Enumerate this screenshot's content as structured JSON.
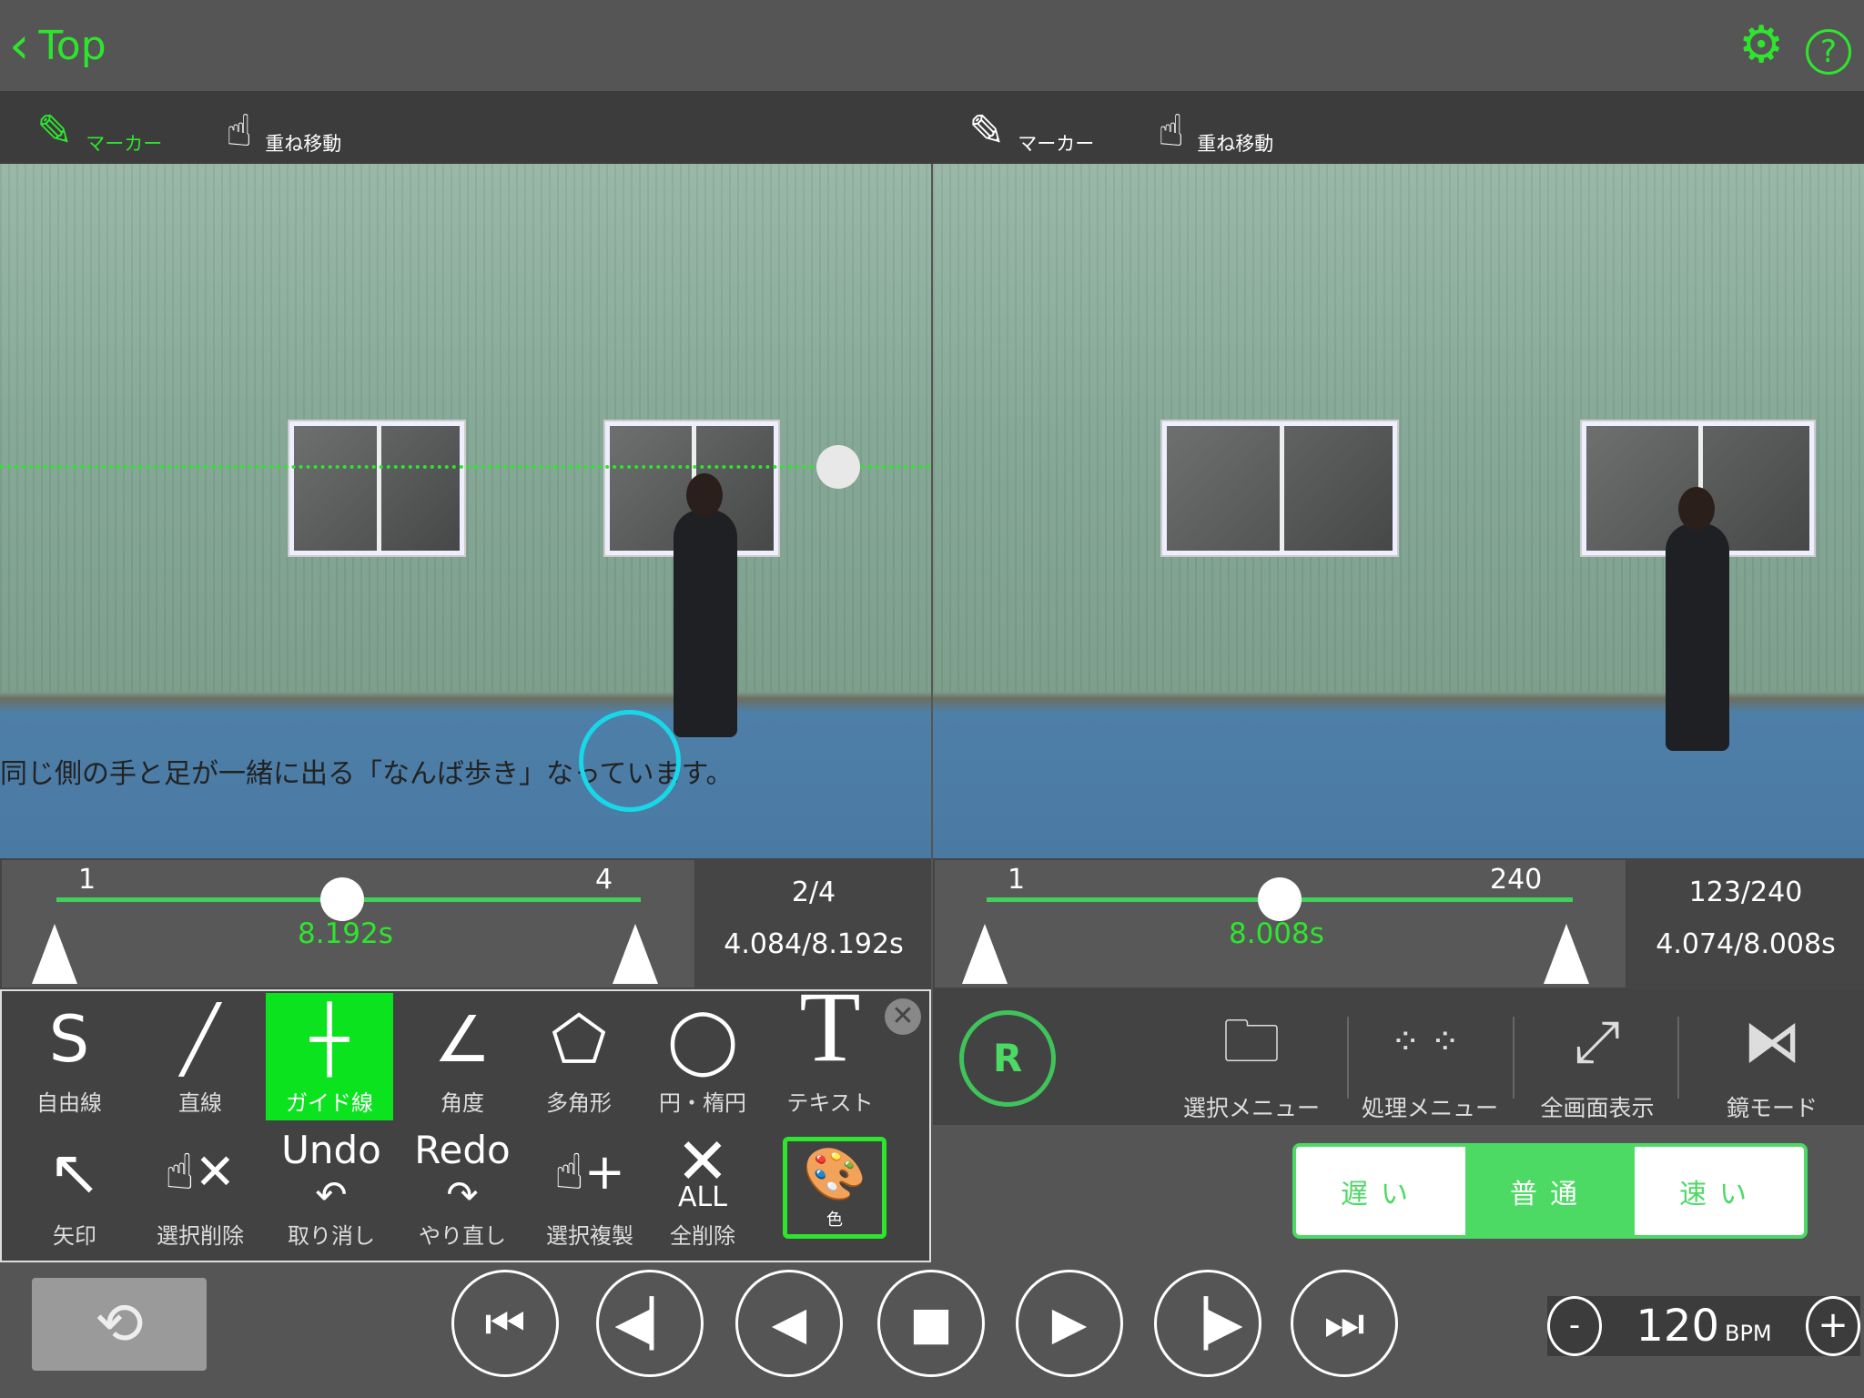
{
  "header": {
    "back_label": "Top",
    "settings_icon": "gear-icon",
    "help_label": "?"
  },
  "colors": {
    "accent": "#2ee52e",
    "speed_green": "#4cd964",
    "guide_line": "#2ee52e",
    "cursor_circle": "#18d8e8"
  },
  "left": {
    "toolbar": {
      "marker_label": "マーカー",
      "overlay_move_label": "重ね移動"
    },
    "caption": "同じ側の手と足が一緒に出る「なんば歩き」なっています。",
    "slider": {
      "start": "1",
      "end": "4",
      "time": "8.192s",
      "position_fraction": 0.5
    },
    "info": {
      "frame": "2/4",
      "time": "4.084/8.192s"
    }
  },
  "right": {
    "toolbar": {
      "marker_label": "マーカー",
      "overlay_move_label": "重ね移動"
    },
    "slider": {
      "start": "1",
      "end": "240",
      "time": "8.008s",
      "position_fraction": 0.51
    },
    "info": {
      "frame": "123/240",
      "time": "4.074/8.008s"
    }
  },
  "tools": {
    "row1": [
      {
        "label": "自由線",
        "icon": "S"
      },
      {
        "label": "直線",
        "icon": "╱"
      },
      {
        "label": "ガイド線",
        "icon": "┼"
      },
      {
        "label": "角度",
        "icon": "∠"
      },
      {
        "label": "多角形",
        "icon": "⬠"
      },
      {
        "label": "円・楕円",
        "icon": "◯"
      },
      {
        "label": "テキスト",
        "icon": "T"
      }
    ],
    "row2": [
      {
        "label": "矢印",
        "icon": "↖"
      },
      {
        "label": "選択削除",
        "icon": "☝✕"
      },
      {
        "label": "取り消し",
        "icon": "Undo"
      },
      {
        "label": "やり直し",
        "icon": "Redo"
      },
      {
        "label": "選択複製",
        "icon": "☝+"
      },
      {
        "label": "全削除",
        "icon": "✕"
      },
      {
        "label": "色",
        "icon": "🎨"
      }
    ],
    "all_label": "ALL",
    "selected": "ガイド線"
  },
  "right_menu": {
    "record_label": "R",
    "items": [
      {
        "label": "選択メニュー",
        "icon": "folder-icon"
      },
      {
        "label": "処理メニュー",
        "icon": "dots-grid-icon"
      },
      {
        "label": "全画面表示",
        "icon": "expand-icon"
      },
      {
        "label": "鏡モード",
        "icon": "mirror-icon"
      }
    ]
  },
  "speed": {
    "options": [
      "遅い",
      "普通",
      "速い"
    ],
    "selected": "普通"
  },
  "playback": {
    "buttons": [
      "first",
      "step-back",
      "play-reverse",
      "stop",
      "play",
      "step-forward",
      "last"
    ]
  },
  "bpm": {
    "value": "120",
    "unit": "BPM",
    "minus": "-",
    "plus": "+"
  }
}
